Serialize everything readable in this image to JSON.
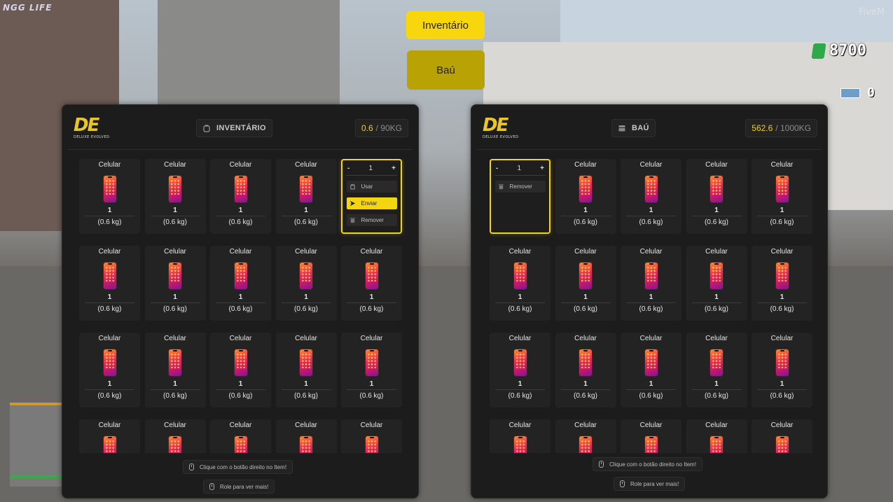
{
  "hud": {
    "top_left": "NGG LIFE",
    "top_right": "FiveM",
    "money": "8700",
    "ammo": "0"
  },
  "tabs": {
    "inventory": "Inventário",
    "chest": "Baú"
  },
  "left_panel": {
    "logo_mark": "DE",
    "logo_sub": "DELUXE EVOLVED",
    "title": "INVENTÁRIO",
    "weight_current": "0.6",
    "weight_max": "/ 90KG",
    "item_name": "Celular",
    "item_qty": "1",
    "item_weight": "(0.6 kg)",
    "selected": {
      "minus": "-",
      "value": "1",
      "plus": "+",
      "actions": [
        "Usar",
        "Enviar",
        "Remover"
      ]
    },
    "hint_click": "Clique com o botão direito no Item!",
    "hint_scroll": "Role para ver mais!"
  },
  "right_panel": {
    "logo_mark": "DE",
    "logo_sub": "DELUXE EVOLVED",
    "title": "BAÚ",
    "weight_current": "562.6",
    "weight_max": "/ 1000KG",
    "item_name": "Celular",
    "item_qty": "1",
    "item_weight": "(0.6 kg)",
    "selected": {
      "minus": "-",
      "value": "1",
      "plus": "+",
      "actions": [
        "Remover"
      ]
    },
    "hint_click": "Clique com o botão direito no Item!",
    "hint_scroll": "Role para ver mais!"
  },
  "colors": {
    "accent": "#f8d60d",
    "panel_bg": "#1c1c1c",
    "slot_bg": "#232323"
  },
  "icons": {
    "inventory": "backpack-icon",
    "chest": "chest-icon",
    "item": "smartphone-icon",
    "use": "hand-icon",
    "send": "send-icon",
    "remove": "trash-icon",
    "mouse": "mouse-icon"
  }
}
